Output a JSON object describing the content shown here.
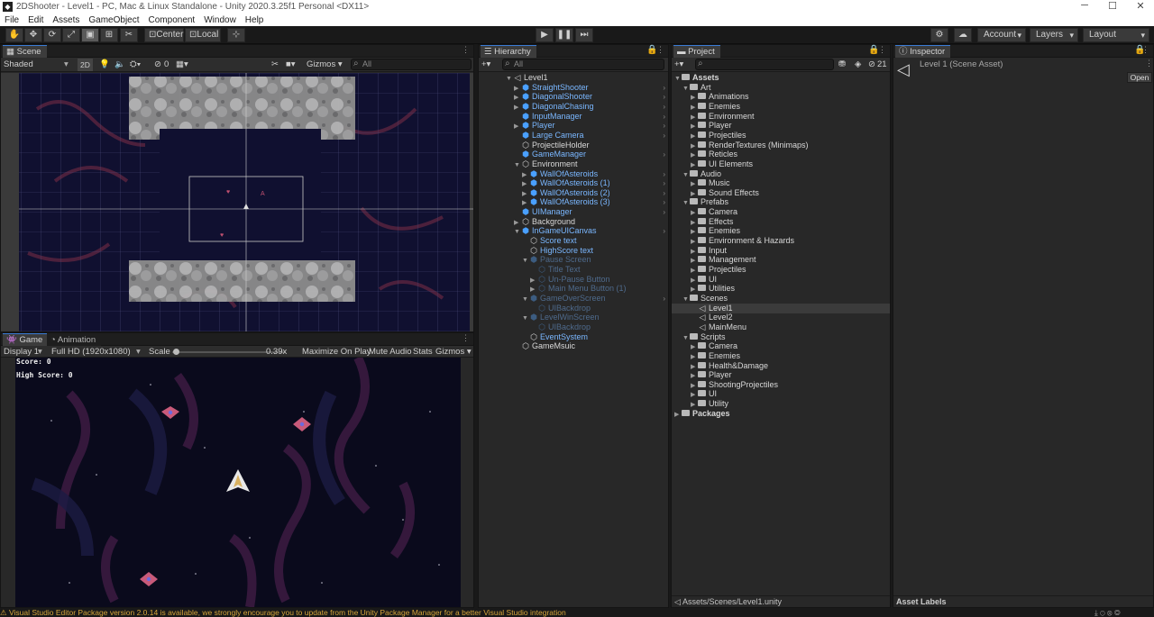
{
  "window": {
    "title": "2DShooter - Level1 - PC, Mac & Linux Standalone - Unity 2020.3.25f1 Personal <DX11>",
    "minimize_icon": "minimize-icon",
    "maximize_icon": "maximize-icon",
    "close_icon": "close-icon"
  },
  "menu": [
    "File",
    "Edit",
    "Assets",
    "GameObject",
    "Component",
    "Window",
    "Help"
  ],
  "toolbar": {
    "pivot": "Center",
    "space": "Local",
    "account": "Account",
    "layers": "Layers",
    "layout": "Layout"
  },
  "scene": {
    "tab": "Scene",
    "shading": "Shaded",
    "mode2d": "2D",
    "hidden_count": "0",
    "gizmos": "Gizmos",
    "search_placeholder": "All"
  },
  "game": {
    "tab": "Game",
    "tab2": "Animation",
    "display": "Display 1",
    "resolution": "Full HD (1920x1080)",
    "scale_label": "Scale",
    "scale_value": "0.39x",
    "scale_fraction": 0.2,
    "maximize": "Maximize On Play",
    "mute": "Mute Audio",
    "stats": "Stats",
    "gizmos": "Gizmos",
    "score": "Score: 0",
    "highscore": "High Score: 0"
  },
  "hierarchy": {
    "tab": "Hierarchy",
    "search_placeholder": "All",
    "items": [
      {
        "label": "Level1",
        "depth": 0,
        "icon": "scene",
        "color": "white",
        "expand": "open"
      },
      {
        "label": "StraightShooter",
        "depth": 1,
        "icon": "prefab",
        "color": "blue",
        "expand": "closed",
        "more": true
      },
      {
        "label": "DiagonalShooter",
        "depth": 1,
        "icon": "prefab",
        "color": "blue",
        "expand": "closed",
        "more": true
      },
      {
        "label": "DiagonalChasing",
        "depth": 1,
        "icon": "prefab",
        "color": "blue",
        "expand": "closed",
        "more": true
      },
      {
        "label": "InputManager",
        "depth": 1,
        "icon": "prefab",
        "color": "blue",
        "expand": "none",
        "more": true
      },
      {
        "label": "Player",
        "depth": 1,
        "icon": "prefab",
        "color": "blue",
        "expand": "closed",
        "more": true
      },
      {
        "label": "Large Camera",
        "depth": 1,
        "icon": "prefab",
        "color": "blue",
        "expand": "none",
        "more": true
      },
      {
        "label": "ProjectileHolder",
        "depth": 1,
        "icon": "object",
        "color": "white",
        "expand": "none",
        "more": false
      },
      {
        "label": "GameManager",
        "depth": 1,
        "icon": "prefab",
        "color": "blue",
        "expand": "none",
        "more": true
      },
      {
        "label": "Environment",
        "depth": 1,
        "icon": "object",
        "color": "white",
        "expand": "open",
        "more": false
      },
      {
        "label": "WallOfAsteroids",
        "depth": 2,
        "icon": "prefab",
        "color": "blue",
        "expand": "closed",
        "more": true
      },
      {
        "label": "WallOfAsteroids (1)",
        "depth": 2,
        "icon": "prefab",
        "color": "blue",
        "expand": "closed",
        "more": true
      },
      {
        "label": "WallOfAsteroids (2)",
        "depth": 2,
        "icon": "prefab",
        "color": "blue",
        "expand": "closed",
        "more": true
      },
      {
        "label": "WallOfAsteroids (3)",
        "depth": 2,
        "icon": "prefab",
        "color": "blue",
        "expand": "closed",
        "more": true
      },
      {
        "label": "UIManager",
        "depth": 1,
        "icon": "prefab",
        "color": "blue",
        "expand": "none",
        "more": true
      },
      {
        "label": "Background",
        "depth": 1,
        "icon": "object",
        "color": "white",
        "expand": "closed",
        "more": false
      },
      {
        "label": "InGameUICanvas",
        "depth": 1,
        "icon": "prefab",
        "color": "blue",
        "expand": "open",
        "more": true
      },
      {
        "label": "Score text",
        "depth": 2,
        "icon": "object",
        "color": "blue",
        "expand": "none",
        "more": false
      },
      {
        "label": "HighScore text",
        "depth": 2,
        "icon": "object",
        "color": "blue",
        "expand": "none",
        "more": false
      },
      {
        "label": "Pause Screen",
        "depth": 2,
        "icon": "prefab",
        "color": "dim",
        "expand": "open",
        "more": false
      },
      {
        "label": "Title Text",
        "depth": 3,
        "icon": "object",
        "color": "dim",
        "expand": "none",
        "more": false
      },
      {
        "label": "Un-Pause Button",
        "depth": 3,
        "icon": "object",
        "color": "dim",
        "expand": "closed",
        "more": false
      },
      {
        "label": "Main Menu Button (1)",
        "depth": 3,
        "icon": "object",
        "color": "dim",
        "expand": "closed",
        "more": false
      },
      {
        "label": "GameOverScreen",
        "depth": 2,
        "icon": "prefab",
        "color": "dim",
        "expand": "open",
        "more": true
      },
      {
        "label": "UIBackdrop",
        "depth": 3,
        "icon": "object",
        "color": "dim",
        "expand": "none",
        "more": false
      },
      {
        "label": "LevelWinScreen",
        "depth": 2,
        "icon": "prefab",
        "color": "dim",
        "expand": "open",
        "more": false
      },
      {
        "label": "UIBackdrop",
        "depth": 3,
        "icon": "object",
        "color": "dim",
        "expand": "none",
        "more": false
      },
      {
        "label": "EventSystem",
        "depth": 2,
        "icon": "object",
        "color": "blue",
        "expand": "none",
        "more": false
      },
      {
        "label": "GameMsuic",
        "depth": 1,
        "icon": "object",
        "color": "white",
        "expand": "none",
        "more": false
      }
    ]
  },
  "project": {
    "tab": "Project",
    "hidden_count": "21",
    "path": "Assets/Scenes/Level1.unity",
    "items": [
      {
        "label": "Assets",
        "depth": 0,
        "icon": "folder",
        "expand": "open",
        "bold": true
      },
      {
        "label": "Art",
        "depth": 1,
        "icon": "folder",
        "expand": "open"
      },
      {
        "label": "Animations",
        "depth": 2,
        "icon": "folder",
        "expand": "closed"
      },
      {
        "label": "Enemies",
        "depth": 2,
        "icon": "folder",
        "expand": "closed"
      },
      {
        "label": "Environment",
        "depth": 2,
        "icon": "folder",
        "expand": "closed"
      },
      {
        "label": "Player",
        "depth": 2,
        "icon": "folder",
        "expand": "closed"
      },
      {
        "label": "Projectiles",
        "depth": 2,
        "icon": "folder",
        "expand": "closed"
      },
      {
        "label": "RenderTextures (Minimaps)",
        "depth": 2,
        "icon": "folder",
        "expand": "closed"
      },
      {
        "label": "Reticles",
        "depth": 2,
        "icon": "folder",
        "expand": "closed"
      },
      {
        "label": "UI Elements",
        "depth": 2,
        "icon": "folder",
        "expand": "closed"
      },
      {
        "label": "Audio",
        "depth": 1,
        "icon": "folder",
        "expand": "open"
      },
      {
        "label": "Music",
        "depth": 2,
        "icon": "folder",
        "expand": "closed"
      },
      {
        "label": "Sound Effects",
        "depth": 2,
        "icon": "folder",
        "expand": "closed"
      },
      {
        "label": "Prefabs",
        "depth": 1,
        "icon": "folder",
        "expand": "open"
      },
      {
        "label": "Camera",
        "depth": 2,
        "icon": "folder",
        "expand": "closed"
      },
      {
        "label": "Effects",
        "depth": 2,
        "icon": "folder",
        "expand": "closed"
      },
      {
        "label": "Enemies",
        "depth": 2,
        "icon": "folder",
        "expand": "closed"
      },
      {
        "label": "Environment & Hazards",
        "depth": 2,
        "icon": "folder",
        "expand": "closed"
      },
      {
        "label": "Input",
        "depth": 2,
        "icon": "folder",
        "expand": "closed"
      },
      {
        "label": "Management",
        "depth": 2,
        "icon": "folder",
        "expand": "closed"
      },
      {
        "label": "Projectiles",
        "depth": 2,
        "icon": "folder",
        "expand": "closed"
      },
      {
        "label": "UI",
        "depth": 2,
        "icon": "folder",
        "expand": "closed"
      },
      {
        "label": "Utilities",
        "depth": 2,
        "icon": "folder",
        "expand": "closed"
      },
      {
        "label": "Scenes",
        "depth": 1,
        "icon": "folder",
        "expand": "open"
      },
      {
        "label": "Level1",
        "depth": 2,
        "icon": "unity",
        "expand": "none",
        "selected": true
      },
      {
        "label": "Level2",
        "depth": 2,
        "icon": "unity",
        "expand": "none"
      },
      {
        "label": "MainMenu",
        "depth": 2,
        "icon": "unity",
        "expand": "none"
      },
      {
        "label": "Scripts",
        "depth": 1,
        "icon": "folder",
        "expand": "open"
      },
      {
        "label": "Camera",
        "depth": 2,
        "icon": "folder",
        "expand": "closed"
      },
      {
        "label": "Enemies",
        "depth": 2,
        "icon": "folder",
        "expand": "closed"
      },
      {
        "label": "Health&Damage",
        "depth": 2,
        "icon": "folder",
        "expand": "closed"
      },
      {
        "label": "Player",
        "depth": 2,
        "icon": "folder",
        "expand": "closed"
      },
      {
        "label": "ShootingProjectiles",
        "depth": 2,
        "icon": "folder",
        "expand": "closed"
      },
      {
        "label": "UI",
        "depth": 2,
        "icon": "folder",
        "expand": "closed"
      },
      {
        "label": "Utility",
        "depth": 2,
        "icon": "folder",
        "expand": "closed"
      },
      {
        "label": "Packages",
        "depth": 0,
        "icon": "folder",
        "expand": "closed",
        "bold": true
      }
    ]
  },
  "inspector": {
    "tab": "Inspector",
    "asset_name": "Level 1 (Scene Asset)",
    "open_button": "Open",
    "asset_labels": "Asset Labels"
  },
  "status": {
    "message": "Visual Studio Editor Package version 2.0.14 is available, we strongly encourage you to update from the Unity Package Manager for a better Visual Studio integration"
  },
  "colors": {
    "accent": "#3a7bd5",
    "prefab_blue": "#7ab7ff",
    "selection": "#3b3b3b",
    "warning": "#d6a53a"
  }
}
